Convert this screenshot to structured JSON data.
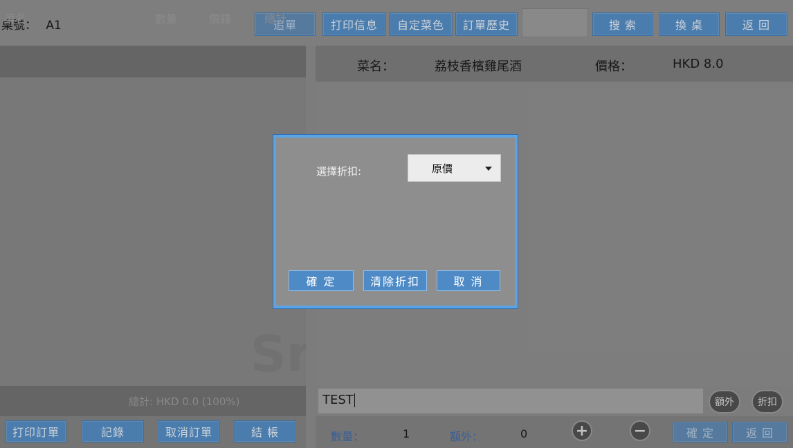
{
  "topbar": {
    "table_label": "桌號：",
    "table_value": "A1",
    "buttons": [
      "追單",
      "打印信息",
      "自定菜色",
      "訂單歷史",
      "搜 索",
      "換 桌",
      "返 回"
    ]
  },
  "order_list": {
    "columns": [
      "菜名",
      "數量",
      "價錢",
      "總計"
    ],
    "total_text": "總計: HKD 0.0 (100%)",
    "ghost_text": "Sr"
  },
  "left_bottom_buttons": [
    "打印訂單",
    "記錄",
    "取消訂單",
    "結 帳"
  ],
  "item_detail": {
    "name_label": "菜名：",
    "name_value": "荔枝香檳雞尾酒",
    "price_label": "價格：",
    "price_value": "HKD 8.0"
  },
  "note_input": {
    "value": "TEST"
  },
  "round_buttons": [
    "額外",
    "折扣"
  ],
  "right_bottom": {
    "qty_label": "數量：",
    "qty_value": "1",
    "extra_label": "額外：",
    "extra_value": "0",
    "plus_icon": "+",
    "minus_icon": "−",
    "confirm": "確 定",
    "back": "返 回"
  },
  "dialog": {
    "label": "選擇折扣:",
    "selected": "原價",
    "buttons": [
      "確 定",
      "清除折扣",
      "取 消"
    ],
    "accent": "#5aa3e6"
  }
}
